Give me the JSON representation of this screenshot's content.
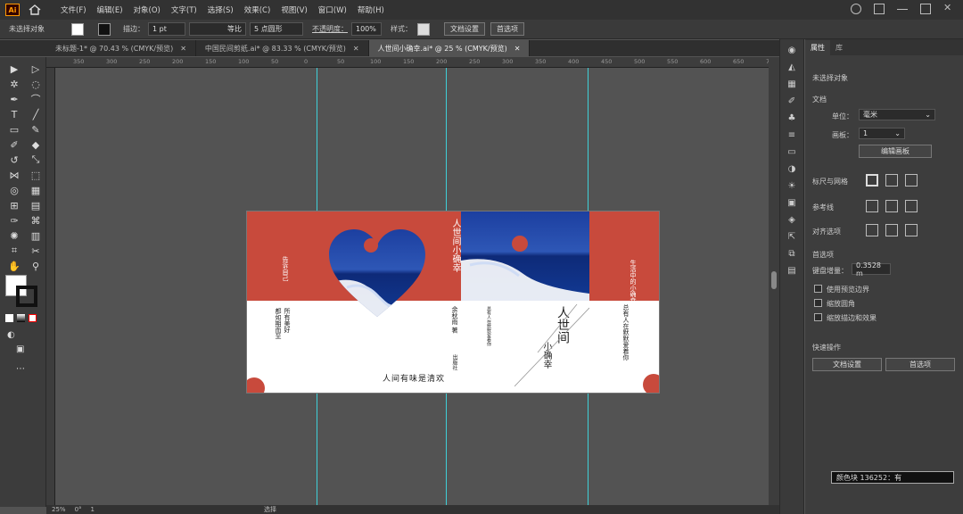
{
  "app": {
    "logo": "Ai"
  },
  "menu": [
    "文件(F)",
    "编辑(E)",
    "对象(O)",
    "文字(T)",
    "选择(S)",
    "效果(C)",
    "视图(V)",
    "窗口(W)",
    "帮助(H)"
  ],
  "control": {
    "no_selection": "未选择对象",
    "stroke_label": "描边：",
    "stroke_value": "1 pt",
    "stroke_style": "等比",
    "brush": "5 点圆形",
    "opacity_label": "不透明度：",
    "opacity_value": "100%",
    "style_label": "样式：",
    "doc_setup": "文档设置",
    "prefs": "首选项"
  },
  "tabs": [
    {
      "label": "未标题-1* @ 70.43 % (CMYK/预览)",
      "active": false
    },
    {
      "label": "中国民间剪纸.ai* @ 83.33 % (CMYK/预览)",
      "active": false
    },
    {
      "label": "人世间小确幸.ai* @ 25 % (CMYK/预览)",
      "active": true
    }
  ],
  "ruler_ticks": [
    "350",
    "300",
    "250",
    "200",
    "150",
    "100",
    "50",
    "0",
    "50",
    "100",
    "150",
    "200",
    "250",
    "300",
    "350",
    "400",
    "450",
    "500",
    "550",
    "600",
    "650",
    "700"
  ],
  "status": {
    "zoom": "25%",
    "angle": "0°",
    "artboard": "1",
    "tool": "选择"
  },
  "cover": {
    "title_main": "人世间",
    "title_sub": "小确幸",
    "spine_title": "人世间小确幸",
    "front_title": "人世间",
    "front_sub": "小确幸",
    "back_red_text": "告诉自己",
    "back_line1": "所有美好",
    "back_line2": "都如期而至",
    "spine_author": "余秋雨 著",
    "front_right_red": "生活中的小确幸",
    "front_right_white": "总有人在默默爱着你",
    "back_bottom_text": "人间有味是清欢",
    "publisher": "出版社",
    "red_accent": "#c84a3c",
    "blue": "#1c3fa0"
  },
  "panel": {
    "tab_props": "属性",
    "tab_layers": "库",
    "no_sel": "未选择对象",
    "doc": "文档",
    "units_label": "单位：",
    "units_value": "毫米",
    "artboard_label": "画板：",
    "artboard_value": "1",
    "edit_artboard": "编辑画板",
    "rulers_grids": "标尺与网格",
    "guides": "参考线",
    "snap": "对齐选项",
    "prefs_head": "首选项",
    "keyboard_inc_label": "键盘增量：",
    "keyboard_inc_value": "0.3528 m",
    "chk1": "使用预览边界",
    "chk2": "缩放圆角",
    "chk3": "缩放描边和效果",
    "quick": "快速操作",
    "doc_setup": "文档设置",
    "prefs_btn": "首选项"
  },
  "tooltip": "颜色块 136252：有"
}
